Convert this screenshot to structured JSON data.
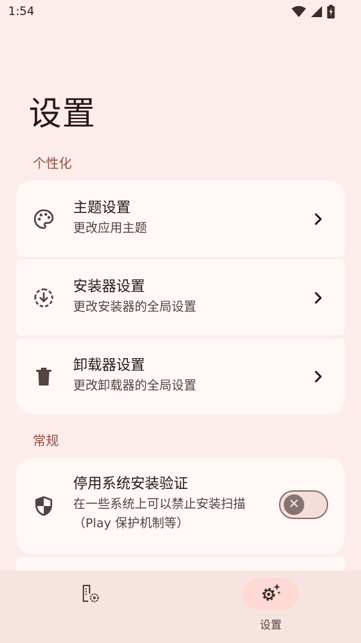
{
  "status_bar": {
    "time": "1:54",
    "icons": [
      "wifi-icon",
      "signal-icon",
      "battery-charging-icon"
    ]
  },
  "page": {
    "title": "设置"
  },
  "sections": {
    "personalize": {
      "label": "个性化",
      "items": [
        {
          "icon": "palette-icon",
          "title": "主题设置",
          "subtitle": "更改应用主题"
        },
        {
          "icon": "install-icon",
          "title": "安装器设置",
          "subtitle": "更改安装器的全局设置"
        },
        {
          "icon": "trash-icon",
          "title": "卸载器设置",
          "subtitle": "更改卸载器的全局设置"
        }
      ]
    },
    "general": {
      "label": "常规",
      "items": [
        {
          "icon": "shield-icon",
          "title": "停用系统安装验证",
          "subtitle": "在一些系统上可以禁止安装扫描（Play 保护机制等）",
          "toggle_on": false
        }
      ]
    }
  },
  "bottom_nav": {
    "items": [
      {
        "icon": "apps-settings-icon",
        "label": "",
        "active": false
      },
      {
        "icon": "gear-sparkle-icon",
        "label": "设置",
        "active": true
      }
    ]
  },
  "colors": {
    "background": "#fcecea",
    "card": "#fff8f7",
    "accent": "#8e4e45",
    "nav_background": "#f7e4e1",
    "nav_active": "#ffdad5"
  }
}
